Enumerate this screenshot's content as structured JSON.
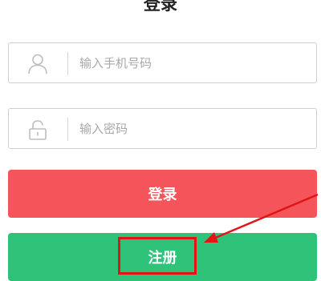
{
  "header": {
    "title": "登录"
  },
  "form": {
    "phone": {
      "placeholder": "输入手机号码",
      "icon": "user-icon"
    },
    "password": {
      "placeholder": "输入密码",
      "icon": "lock-icon"
    }
  },
  "buttons": {
    "login_label": "登录",
    "register_label": "注册"
  },
  "annotation": {
    "color": "#e01616",
    "target": "注册"
  },
  "colors": {
    "login": "#f5555a",
    "register": "#2fc37a"
  }
}
